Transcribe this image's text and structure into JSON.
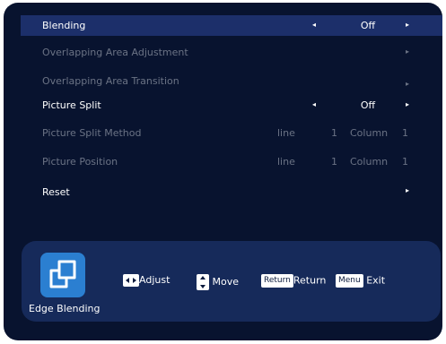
{
  "menu": {
    "items": [
      {
        "label": "Blending",
        "value": "Off",
        "left_arrow": "◂",
        "right_arrow": "▸"
      },
      {
        "label": "Overlapping Area Adjustment",
        "right_arrow": "▸"
      },
      {
        "label": "Overlapping Area Transition",
        "right_arrow": "▸"
      },
      {
        "label": "Picture Split",
        "value": "Off",
        "left_arrow": "◂",
        "right_arrow": "▸"
      },
      {
        "label": "Picture Split Method",
        "line_label": "line",
        "line_value": "1",
        "column_label": "Column",
        "column_value": "1"
      },
      {
        "label": "Picture Position",
        "line_label": "line",
        "line_value": "1",
        "column_label": "Column",
        "column_value": "1"
      },
      {
        "label": "Reset",
        "right_arrow": "▸"
      }
    ]
  },
  "footer": {
    "app_name": "Edge Blending",
    "hints": {
      "adjust": "Adjust",
      "move": "Move",
      "return_key": "Return",
      "return_label": "Return",
      "menu_key": "Menu",
      "exit_label": "Exit"
    }
  },
  "colors": {
    "background": "#08132f",
    "selected_row": "#1c2f6a",
    "footer_panel": "#162a5a",
    "app_icon": "#2b7fd1",
    "disabled_text": "#6b7385"
  },
  "icons": {
    "app_icon": "edge-blending-icon",
    "adjust_key": "left-right-arrows-icon",
    "move_key": "up-down-arrows-icon"
  }
}
